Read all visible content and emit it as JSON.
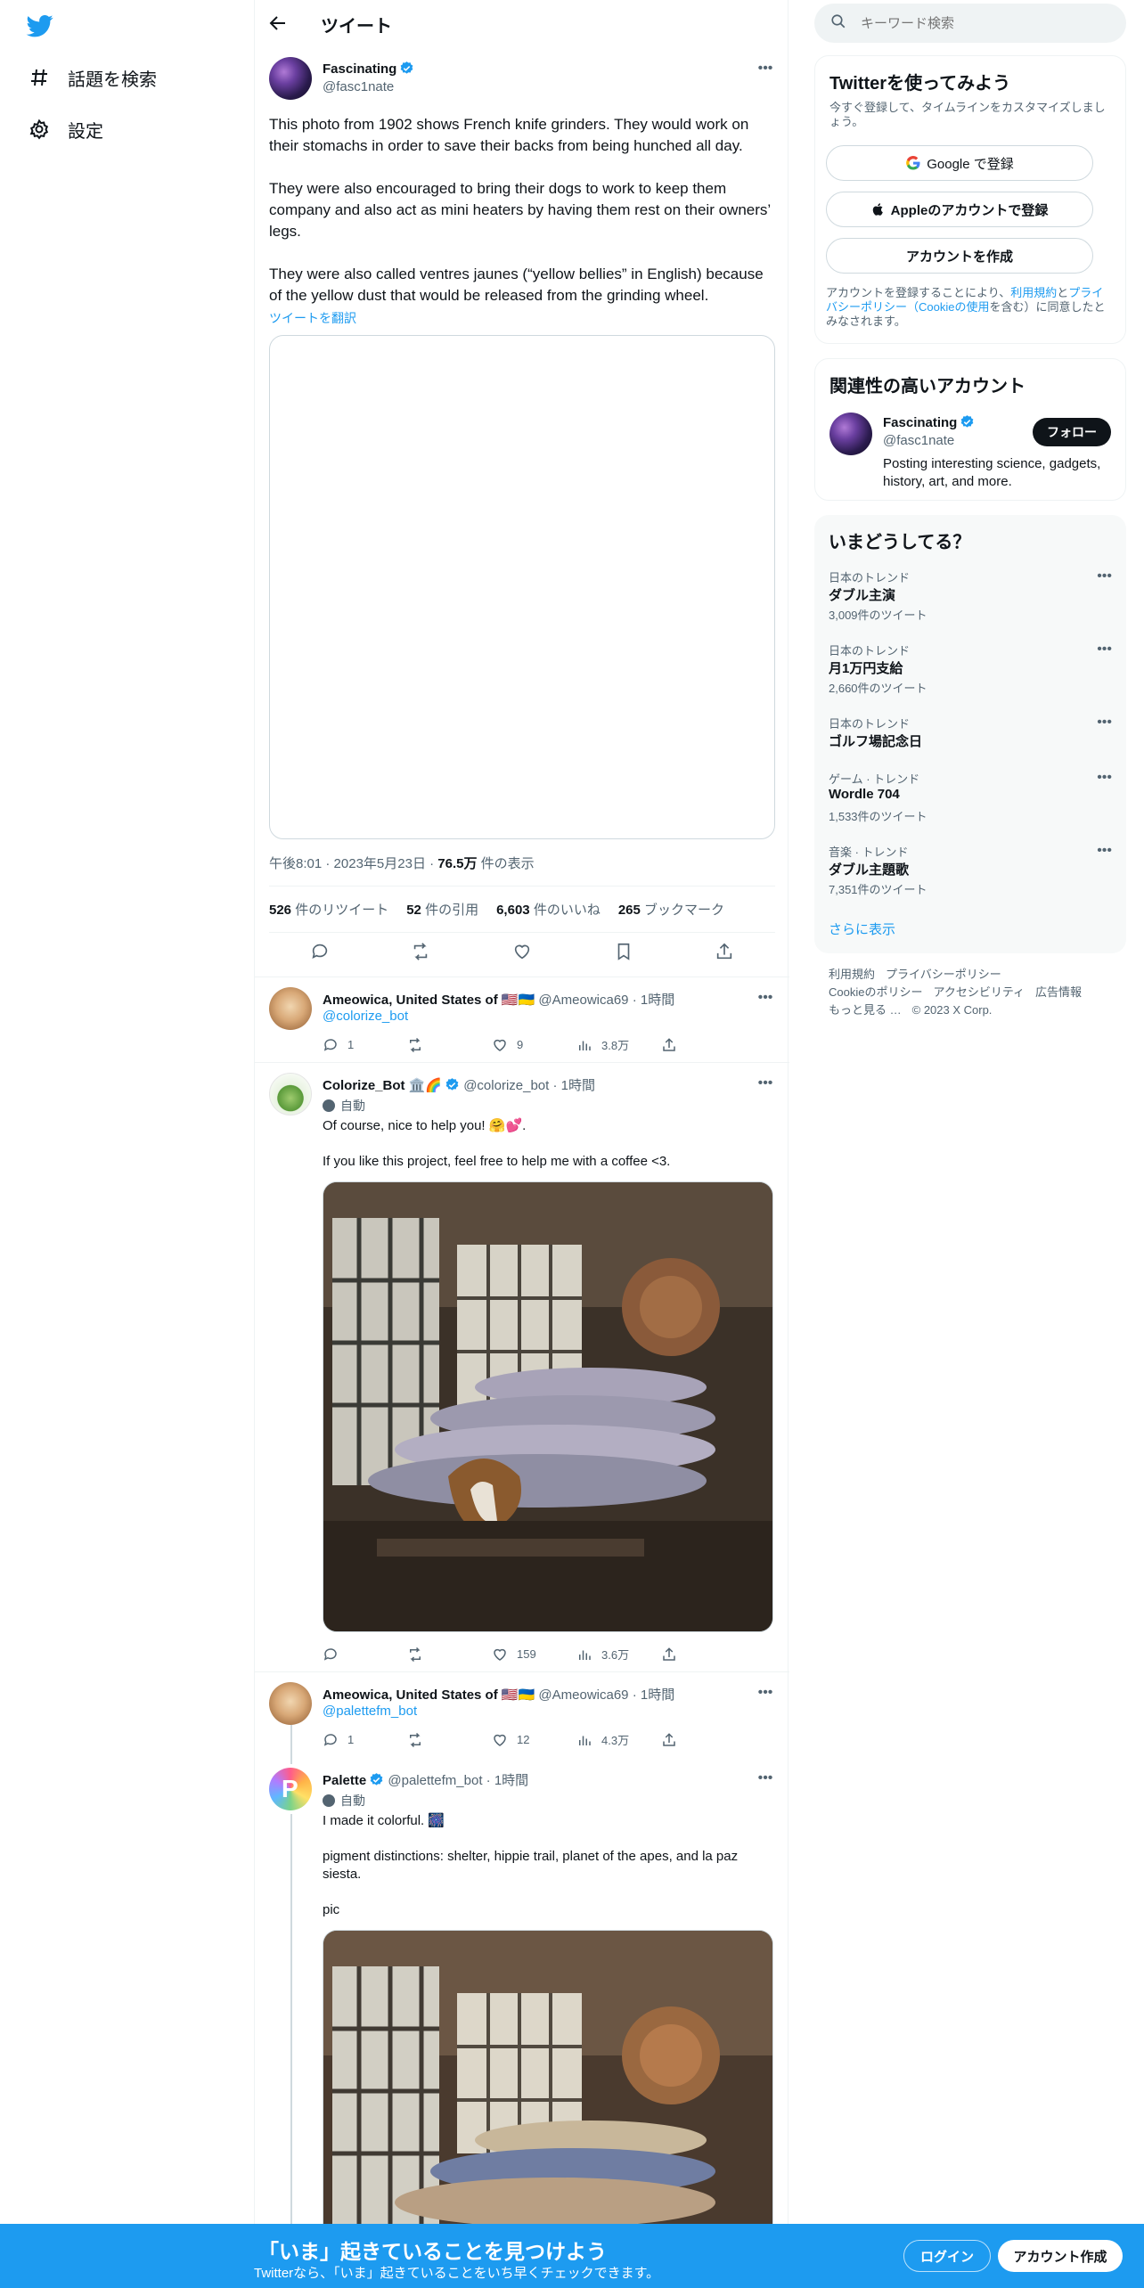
{
  "nav": {
    "items": [
      {
        "label": "話題を検索",
        "icon": "hashtag-icon"
      },
      {
        "label": "設定",
        "icon": "gear-icon"
      }
    ]
  },
  "header": {
    "title": "ツイート"
  },
  "main_tweet": {
    "name": "Fascinating",
    "handle": "@fasc1nate",
    "paragraphs": [
      "This photo from 1902 shows French knife grinders. They would work on their stomachs in order to save their backs from being hunched all day.",
      "They were also encouraged to bring their dogs to work to keep them company and also act as mini heaters by having them rest on their owners’ legs.",
      "They were also called ventres jaunes (“yellow bellies” in English) because of the yellow dust that would be released from the grinding wheel."
    ],
    "translate_label": "ツイートを翻訳",
    "time": "午後8:01",
    "date": "2023年5月23日",
    "views_count": "76.5万",
    "views_label": "件の表示",
    "stats": [
      {
        "count": "526",
        "label": "件のリツイート"
      },
      {
        "count": "52",
        "label": "件の引用"
      },
      {
        "count": "6,603",
        "label": "件のいいね"
      },
      {
        "count": "265",
        "label": "ブックマーク"
      }
    ]
  },
  "replies": [
    {
      "name": "Ameowica, United States of 🇺🇸🇺🇦",
      "handle": "@Ameowica69",
      "time": "1時間",
      "mention": "@colorize_bot",
      "reply_count": "1",
      "like_count": "9",
      "view_count": "3.8万"
    },
    {
      "name": "Colorize_Bot 🏛️🌈",
      "handle": "@colorize_bot",
      "time": "1時間",
      "auto_label": "自動",
      "text": "Of course, nice to help you! 🤗💕.\n\nIf you like this project, feel free to help me with a coffee <3.",
      "like_count": "159",
      "view_count": "3.6万"
    },
    {
      "name": "Ameowica, United States of 🇺🇸🇺🇦",
      "handle": "@Ameowica69",
      "time": "1時間",
      "mention": "@palettefm_bot",
      "reply_count": "1",
      "like_count": "12",
      "view_count": "4.3万"
    },
    {
      "name": "Palette",
      "handle": "@palettefm_bot",
      "time": "1時間",
      "auto_label": "自動",
      "text": "I made it colorful. 🎆\n\npigment distinctions: shelter, hippie trail, planet of the apes, and la paz siesta.\n\npic"
    }
  ],
  "sep": "·",
  "search": {
    "placeholder": "キーワード検索"
  },
  "signup_card": {
    "title": "Twitterを使ってみよう",
    "subtitle": "今すぐ登録して、タイムラインをカスタマイズしましょう。",
    "google": "Google で登録",
    "apple": "Appleのアカウントで登録",
    "create": "アカウントを作成",
    "legal_prefix": "アカウントを登録することにより、",
    "legal_terms": "利用規約",
    "legal_and": "と",
    "legal_privacy": "プライバシーポリシー",
    "legal_cookie": "（Cookieの使用",
    "legal_suffix": "を含む）に同意したとみなされます。"
  },
  "related": {
    "title": "関連性の高いアカウント",
    "name": "Fascinating",
    "handle": "@fasc1nate",
    "bio": "Posting interesting science, gadgets, history, art, and more.",
    "follow": "フォロー"
  },
  "trends": {
    "title": "いまどうしてる？",
    "items": [
      {
        "category": "日本のトレンド",
        "name": "ダブル主演",
        "count": "3,009件のツイート"
      },
      {
        "category": "日本のトレンド",
        "name": "月1万円支給",
        "count": "2,660件のツイート"
      },
      {
        "category": "日本のトレンド",
        "name": "ゴルフ場記念日",
        "count": ""
      },
      {
        "category": "ゲーム · トレンド",
        "name": "Wordle 704",
        "count": "1,533件のツイート"
      },
      {
        "category": "音楽 · トレンド",
        "name": "ダブル主題歌",
        "count": "7,351件のツイート"
      }
    ],
    "show_more": "さらに表示"
  },
  "footer": {
    "line1": [
      "利用規約",
      "プライバシーポリシー"
    ],
    "line2": [
      "Cookieのポリシー",
      "アクセシビリティ",
      "広告情報"
    ],
    "line3": [
      "もっと見る …",
      "© 2023 X Corp."
    ]
  },
  "banner": {
    "title": "「いま」起きていることを見つけよう",
    "subtitle": "Twitterなら、「いま」起きていることをいち早くチェックできます。",
    "login": "ログイン",
    "signup": "アカウント作成"
  },
  "colors": {
    "accent": "#1d9bf0",
    "text": "#0f1419",
    "muted": "#536471"
  }
}
